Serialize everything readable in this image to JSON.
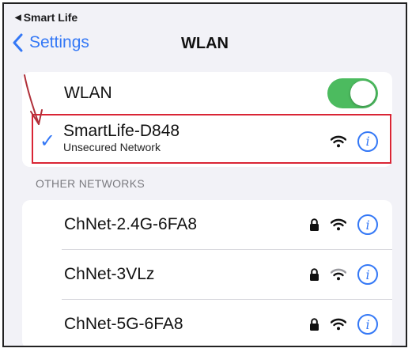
{
  "status_bar": {
    "back_app": "Smart Life"
  },
  "nav": {
    "back_label": "Settings",
    "title": "WLAN"
  },
  "wlan": {
    "label": "WLAN",
    "enabled": true
  },
  "connected": {
    "ssid": "SmartLife-D848",
    "subtitle": "Unsecured Network"
  },
  "other": {
    "header": "OTHER NETWORKS",
    "networks": [
      {
        "ssid": "ChNet-2.4G-6FA8",
        "secured": true
      },
      {
        "ssid": "ChNet-3VLz",
        "secured": true
      },
      {
        "ssid": "ChNet-5G-6FA8",
        "secured": true
      }
    ]
  },
  "colors": {
    "accent": "#3478f6",
    "toggle_on": "#4cbb5f",
    "highlight": "#d92535",
    "annotation_arrow": "#b0303a"
  },
  "icons": [
    "back-triangle-icon",
    "chevron-left-icon",
    "checkmark-icon",
    "wifi-icon",
    "lock-icon",
    "info-icon",
    "annotation-arrow-icon"
  ]
}
